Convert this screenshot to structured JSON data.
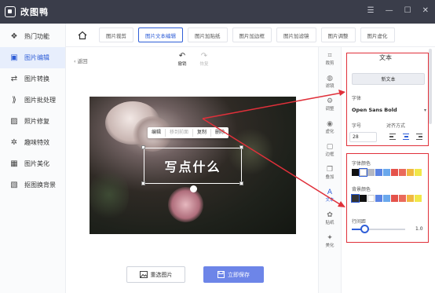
{
  "app": {
    "title": "改图鸭"
  },
  "sidebar": {
    "items": [
      {
        "label": "热门功能",
        "icon": "grid-icon",
        "active": false
      },
      {
        "label": "图片编辑",
        "icon": "image-edit-icon",
        "active": true
      },
      {
        "label": "图片转换",
        "icon": "convert-icon",
        "active": false
      },
      {
        "label": "图片批处理",
        "icon": "batch-icon",
        "active": false
      },
      {
        "label": "照片修复",
        "icon": "repair-icon",
        "active": false
      },
      {
        "label": "趣味特效",
        "icon": "sparkle-icon",
        "active": false
      },
      {
        "label": "图片美化",
        "icon": "beautify-icon",
        "active": false
      },
      {
        "label": "抠图换背景",
        "icon": "cutout-icon",
        "active": false
      }
    ]
  },
  "toolbar": {
    "tabs": [
      {
        "label": "图片裁剪",
        "active": false
      },
      {
        "label": "图片文本编辑",
        "active": true
      },
      {
        "label": "图片加贴纸",
        "active": false
      },
      {
        "label": "图片加边框",
        "active": false
      },
      {
        "label": "图片加滤镜",
        "active": false
      },
      {
        "label": "图片调整",
        "active": false
      },
      {
        "label": "图片虚化",
        "active": false
      }
    ]
  },
  "canvas": {
    "back_label": "返回",
    "undo_label": "撤销",
    "redo_label": "恢复",
    "text_content": "写点什么",
    "context_menu": [
      {
        "label": "编辑",
        "enabled": true
      },
      {
        "label": "移到前面",
        "enabled": false
      },
      {
        "label": "复制",
        "enabled": true
      },
      {
        "label": "删除",
        "enabled": true
      }
    ],
    "reselect_label": "重选图片",
    "save_label": "立即保存"
  },
  "tool_strip": [
    {
      "label": "裁剪",
      "icon": "crop-icon"
    },
    {
      "label": "滤镜",
      "icon": "filter-icon"
    },
    {
      "label": "调整",
      "icon": "adjust-icon"
    },
    {
      "label": "虚化",
      "icon": "blur-icon"
    },
    {
      "label": "边框",
      "icon": "border-icon"
    },
    {
      "label": "叠加",
      "icon": "overlay-icon"
    },
    {
      "label": "文本",
      "icon": "text-icon",
      "active": true
    },
    {
      "label": "贴纸",
      "icon": "sticker-icon"
    },
    {
      "label": "美化",
      "icon": "beautify-icon"
    }
  ],
  "text_panel": {
    "title": "文本",
    "new_text_label": "新文本",
    "font_label": "字体",
    "font_value": "Open Sans Bold",
    "size_label": "字号",
    "size_value": "28",
    "align_label": "对齐方式",
    "font_color_label": "字体颜色",
    "bg_color_label": "背景颜色",
    "line_spacing_label": "行间距",
    "line_spacing_value": "1.0",
    "line_spacing_fraction": 0.25,
    "font_colors": [
      "#111111",
      "#ffffff",
      "#b5b8c2",
      "#5b83e3",
      "#6aa8ec",
      "#e4534b",
      "#ea6a5b",
      "#f1b840",
      "#f1e748"
    ],
    "bg_colors": [
      "#333333",
      "#111111",
      "#ffffff",
      "#5b83e3",
      "#6aa8ec",
      "#e4534b",
      "#ea6a5b",
      "#f1b840",
      "#f1e748"
    ],
    "accent": "#2f5ed7",
    "highlight": "#e0303a"
  }
}
